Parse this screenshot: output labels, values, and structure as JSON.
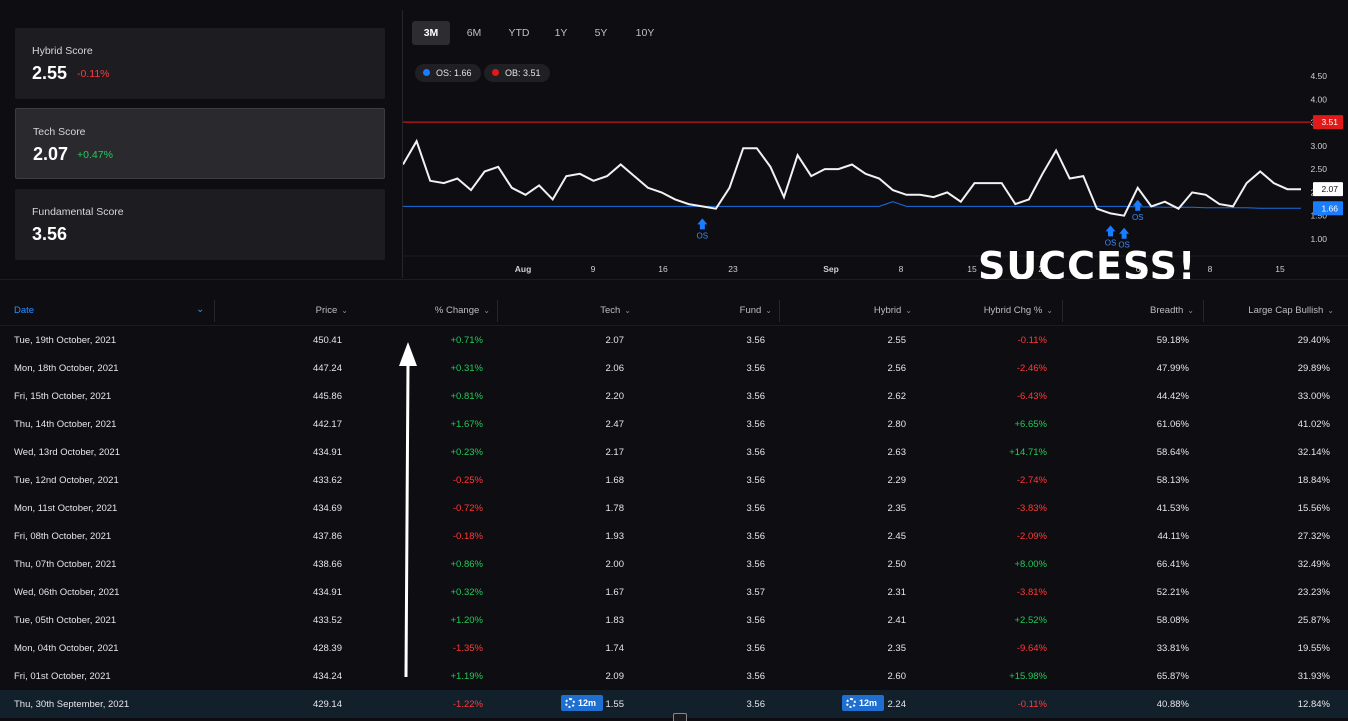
{
  "scores": {
    "hybrid": {
      "label": "Hybrid Score",
      "value": "2.55",
      "change": "-0.11%"
    },
    "tech": {
      "label": "Tech Score",
      "value": "2.07",
      "change": "+0.47%"
    },
    "fundamental": {
      "label": "Fundamental Score",
      "value": "3.56"
    }
  },
  "ranges": [
    "3M",
    "6M",
    "YTD",
    "1Y",
    "5Y",
    "10Y"
  ],
  "active_range": "3M",
  "legend": {
    "os": "OS: 1.66",
    "ob": "OB: 3.51"
  },
  "overlay_text": "SUCCESS!",
  "colors": {
    "os": "#1a7cff",
    "ob": "#e01919",
    "positive": "#25c85b",
    "negative": "#ff3a3a",
    "accent": "#2f8fff"
  },
  "chart_data": {
    "type": "line",
    "y_ticks": [
      "4.50",
      "4.00",
      "3.50",
      "3.00",
      "2.50",
      "2.00",
      "1.50",
      "1.00"
    ],
    "ylim": [
      0.5,
      4.7
    ],
    "x_tick_labels": [
      "Aug",
      "9",
      "16",
      "23",
      "Sep",
      "8",
      "15",
      "22",
      "6",
      "8",
      "15"
    ],
    "overbought": 3.51,
    "oversold": 1.66,
    "last_value_label": "2.07",
    "ob_label": "3.51",
    "os_label": "1.66",
    "signal_label": "OS",
    "signals": [
      {
        "x": 22
      },
      {
        "x": 52
      },
      {
        "x": 53
      },
      {
        "x": 54
      }
    ],
    "series": [
      {
        "values": [
          2.6,
          3.1,
          2.25,
          2.2,
          2.3,
          2.05,
          2.45,
          2.55,
          2.1,
          1.95,
          2.15,
          1.85,
          2.35,
          2.4,
          2.25,
          2.35,
          2.6,
          2.35,
          2.1,
          2.0,
          1.85,
          1.75,
          1.7,
          1.65,
          2.1,
          2.95,
          2.95,
          2.55,
          1.9,
          2.8,
          2.35,
          2.5,
          2.5,
          2.6,
          2.4,
          2.3,
          2.05,
          1.95,
          1.95,
          1.9,
          2.0,
          1.8,
          2.2,
          2.2,
          2.2,
          1.75,
          1.85,
          2.4,
          2.9,
          2.3,
          2.35,
          1.65,
          1.55,
          1.5,
          2.1,
          1.7,
          1.8,
          1.65,
          2.0,
          1.95,
          1.75,
          1.7,
          2.2,
          2.45,
          2.2,
          2.07,
          2.07
        ]
      },
      {
        "values": [
          1.7,
          1.7,
          1.7,
          1.7,
          1.7,
          1.7,
          1.7,
          1.7,
          1.7,
          1.7,
          1.7,
          1.7,
          1.7,
          1.7,
          1.7,
          1.7,
          1.7,
          1.7,
          1.7,
          1.7,
          1.7,
          1.7,
          1.7,
          1.7,
          1.7,
          1.7,
          1.7,
          1.7,
          1.7,
          1.7,
          1.7,
          1.7,
          1.7,
          1.7,
          1.7,
          1.7,
          1.8,
          1.7,
          1.7,
          1.7,
          1.7,
          1.7,
          1.7,
          1.7,
          1.7,
          1.7,
          1.7,
          1.7,
          1.7,
          1.7,
          1.7,
          1.7,
          1.7,
          1.7,
          1.69,
          1.69,
          1.68,
          1.68,
          1.68,
          1.67,
          1.67,
          1.67,
          1.67,
          1.66,
          1.66,
          1.66,
          1.66
        ]
      }
    ]
  },
  "table": {
    "headers": [
      "Date",
      "Price",
      "% Change",
      "Tech",
      "Fund",
      "Hybrid",
      "Hybrid Chg %",
      "Breadth",
      "Large Cap Bullish"
    ],
    "badge_label": "12m",
    "rows": [
      [
        "Tue, 19th October, 2021",
        "450.41",
        "+0.71%",
        "2.07",
        "3.56",
        "2.55",
        "-0.11%",
        "59.18%",
        "29.40%"
      ],
      [
        "Mon, 18th October, 2021",
        "447.24",
        "+0.31%",
        "2.06",
        "3.56",
        "2.56",
        "-2.46%",
        "47.99%",
        "29.89%"
      ],
      [
        "Fri, 15th October, 2021",
        "445.86",
        "+0.81%",
        "2.20",
        "3.56",
        "2.62",
        "-6.43%",
        "44.42%",
        "33.00%"
      ],
      [
        "Thu, 14th October, 2021",
        "442.17",
        "+1.67%",
        "2.47",
        "3.56",
        "2.80",
        "+6.65%",
        "61.06%",
        "41.02%"
      ],
      [
        "Wed, 13rd October, 2021",
        "434.91",
        "+0.23%",
        "2.17",
        "3.56",
        "2.63",
        "+14.71%",
        "58.64%",
        "32.14%"
      ],
      [
        "Tue, 12nd October, 2021",
        "433.62",
        "-0.25%",
        "1.68",
        "3.56",
        "2.29",
        "-2.74%",
        "58.13%",
        "18.84%"
      ],
      [
        "Mon, 11st October, 2021",
        "434.69",
        "-0.72%",
        "1.78",
        "3.56",
        "2.35",
        "-3.83%",
        "41.53%",
        "15.56%"
      ],
      [
        "Fri, 08th October, 2021",
        "437.86",
        "-0.18%",
        "1.93",
        "3.56",
        "2.45",
        "-2.09%",
        "44.11%",
        "27.32%"
      ],
      [
        "Thu, 07th October, 2021",
        "438.66",
        "+0.86%",
        "2.00",
        "3.56",
        "2.50",
        "+8.00%",
        "66.41%",
        "32.49%"
      ],
      [
        "Wed, 06th October, 2021",
        "434.91",
        "+0.32%",
        "1.67",
        "3.57",
        "2.31",
        "-3.81%",
        "52.21%",
        "23.23%"
      ],
      [
        "Tue, 05th October, 2021",
        "433.52",
        "+1.20%",
        "1.83",
        "3.56",
        "2.41",
        "+2.52%",
        "58.08%",
        "25.87%"
      ],
      [
        "Mon, 04th October, 2021",
        "428.39",
        "-1.35%",
        "1.74",
        "3.56",
        "2.35",
        "-9.64%",
        "33.81%",
        "19.55%"
      ],
      [
        "Fri, 01st October, 2021",
        "434.24",
        "+1.19%",
        "2.09",
        "3.56",
        "2.60",
        "+15.98%",
        "65.87%",
        "31.93%"
      ],
      [
        "Thu, 30th September, 2021",
        "429.14",
        "-1.22%",
        "1.55",
        "3.56",
        "2.24",
        "-0.11%",
        "40.88%",
        "12.84%"
      ]
    ]
  }
}
